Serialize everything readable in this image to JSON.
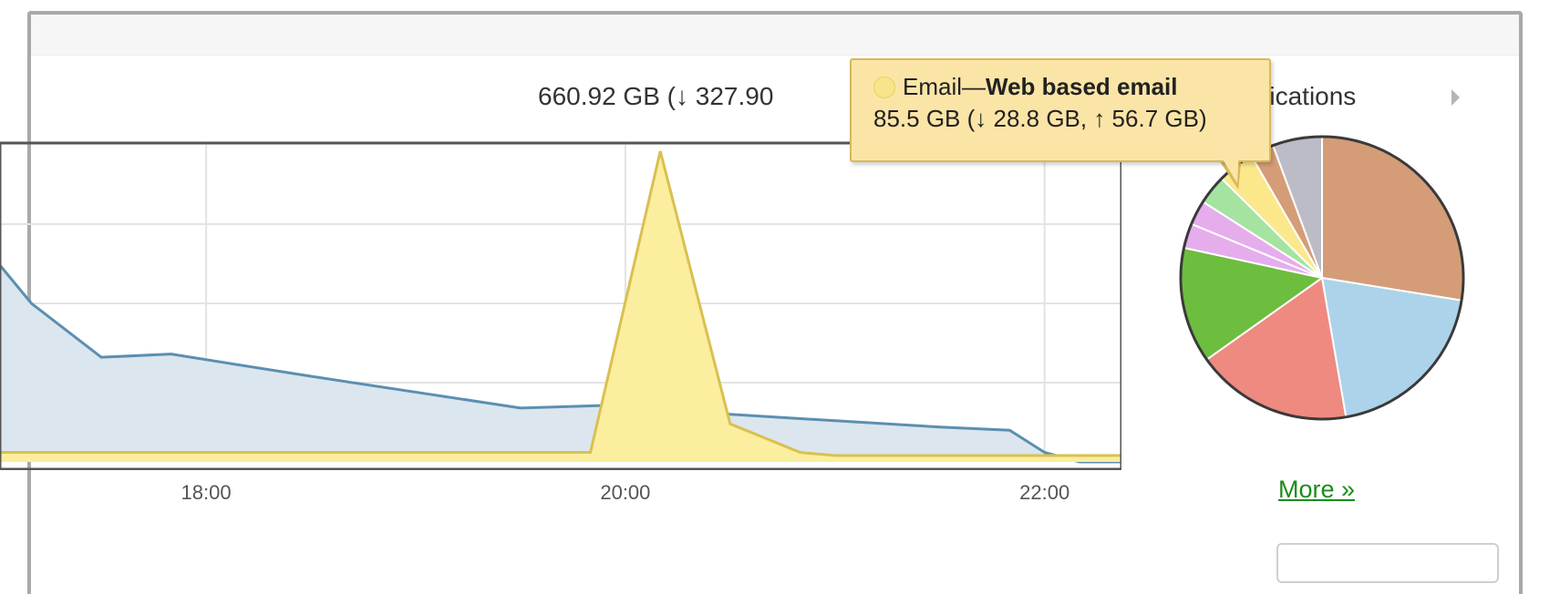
{
  "summary": {
    "text": "660.92 GB  (↓ 327.90"
  },
  "applications": {
    "label": "pplications"
  },
  "tooltip": {
    "category": "Email—",
    "name": "Web based email",
    "detail": "85.5 GB (↓ 28.8 GB, ↑ 56.7 GB)"
  },
  "more_link": "More »",
  "colors": {
    "total_line": "#5b8fb0",
    "total_fill": "#dce6ee",
    "email_fill": "#fbee9e",
    "email_line": "#d9c050",
    "more_link": "#1a8d1a",
    "tooltip_bg": "#fbe5a6"
  },
  "icons": [
    "chevron-right-icon",
    "legend-swatch-icon"
  ],
  "chart_data": [
    {
      "type": "area",
      "title": "",
      "x_ticks": [
        "18:00",
        "20:00",
        "22:00"
      ],
      "x_range": [
        "17:01",
        "22:22"
      ],
      "grid": true,
      "series": [
        {
          "values_x": [
            "17:01",
            "17:10",
            "17:30",
            "17:50",
            "18:30",
            "19:00",
            "19:30",
            "20:00",
            "20:30",
            "21:00",
            "21:30",
            "21:50",
            "22:00",
            "22:10",
            "22:22"
          ],
          "values_y": [
            0.62,
            0.5,
            0.33,
            0.34,
            0.27,
            0.22,
            0.17,
            0.18,
            0.15,
            0.13,
            0.11,
            0.1,
            0.03,
            0.0,
            0.0
          ]
        },
        {
          "name": "Email—Web based email",
          "values_x": [
            "17:01",
            "19:50",
            "20:10",
            "20:30",
            "20:50",
            "21:00",
            "22:22"
          ],
          "values_y": [
            0.03,
            0.03,
            0.98,
            0.12,
            0.03,
            0.02,
            0.02
          ]
        }
      ]
    },
    {
      "type": "pie",
      "title": "",
      "slices": [
        {
          "value": 25.4,
          "color": "#d49d78"
        },
        {
          "value": 18.2,
          "color": "#acd3ea"
        },
        {
          "value": 16.5,
          "color": "#ee8a80"
        },
        {
          "value": 12.2,
          "color": "#6dbd3f"
        },
        {
          "value": 2.6,
          "color": "#e5adec"
        },
        {
          "value": 2.6,
          "color": "#e5adec"
        },
        {
          "value": 3.1,
          "color": "#a5e3a1"
        },
        {
          "value": 3.9,
          "color": "#fbe88b"
        },
        {
          "value": 2.5,
          "color": "#d49d78"
        },
        {
          "value": 5.2,
          "color": "#bcbcc6"
        }
      ]
    }
  ]
}
